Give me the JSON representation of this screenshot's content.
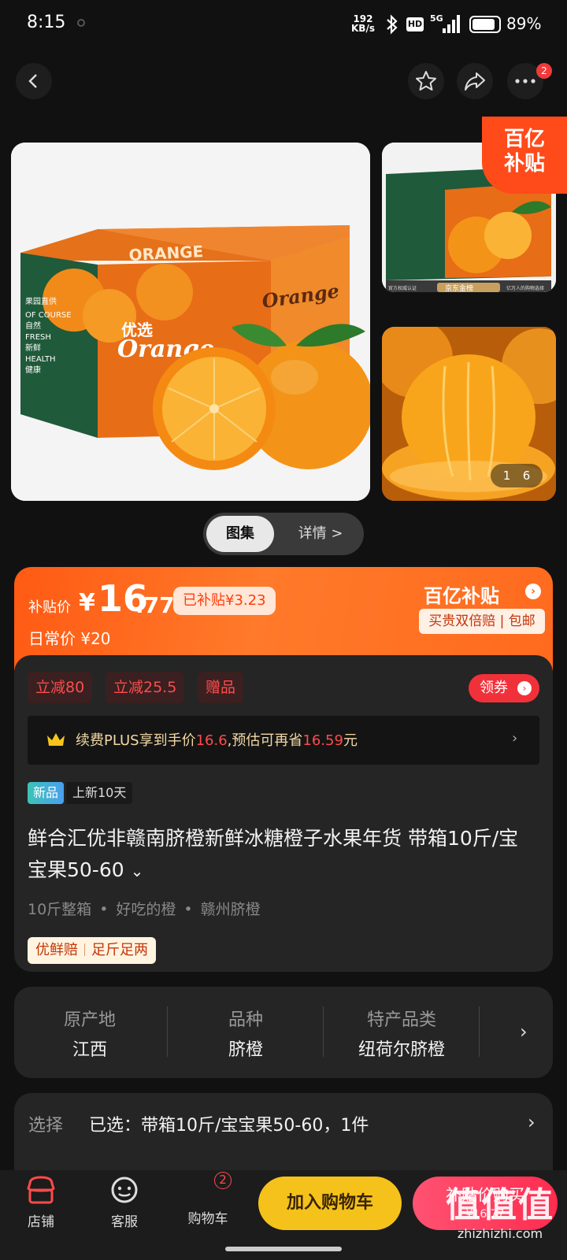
{
  "status_bar": {
    "time": "8:15",
    "net_speed_value": "192",
    "net_speed_unit": "KB/s",
    "hd": "HD",
    "network": "5G",
    "battery_pct": "89%",
    "battery_level": 0.89
  },
  "nav": {
    "more_badge": "2"
  },
  "gallery": {
    "corner_line1": "百亿",
    "corner_line2": "补贴",
    "page_current": "1",
    "page_total": "6",
    "main_box_text": "ORANGE",
    "main_box_side": [
      "果园直供",
      "OF COURSE",
      "自然",
      "FRESH",
      "新鲜",
      "HEALTH",
      "健康"
    ],
    "main_box_brand": "优选",
    "main_box_script": "Orange",
    "thumb1_banner": "京东金榜",
    "thumb1_left": "官方权威认证",
    "thumb1_right": "亿万人的购物选择"
  },
  "view_toggle": {
    "gallery_label": "图集",
    "details_label": "详情 >"
  },
  "price": {
    "label": "补贴价",
    "yen": "¥",
    "integer": "16",
    "decimal": ".77",
    "subsidized": "已补贴¥3.23",
    "daily": "日常价 ¥20",
    "brand": "百亿补贴",
    "brand_arrow": "›",
    "slogan": "买贵双倍赔 | 包邮"
  },
  "promos": {
    "tag1": "立减80",
    "tag2": "立减25.5",
    "tag3": "赠品",
    "coupon": "领券",
    "coupon_arrow": "›"
  },
  "plus": {
    "pre": "续费PLUS享到手价",
    "price": "16.6",
    "mid": ",预估可再省",
    "save": "16.59",
    "post": "元",
    "chevron": "›"
  },
  "new_badge": {
    "label": "新品",
    "date": "上新10天"
  },
  "product": {
    "title": "鲜合汇优非赣南脐橙新鲜冰糖橙子水果年货 带箱10斤/宝宝果50-60",
    "expand": "⌄",
    "spec1": "10斤整箱",
    "spec2": "好吃的橙",
    "spec3": "赣州脐橙",
    "dot": "•",
    "service1": "优鲜赔",
    "service2": "足斤足两"
  },
  "attributes": {
    "origin_key": "原产地",
    "origin_val": "江西",
    "variety_key": "品种",
    "variety_val": "脐橙",
    "category_key": "特产品类",
    "category_val": "纽荷尔脐橙",
    "chevron": "›"
  },
  "selection": {
    "label": "选择",
    "value": "已选：带箱10斤/宝宝果50-60，1件",
    "chevron": "›"
  },
  "bottom_bar": {
    "store": "店铺",
    "service": "客服",
    "cart": "购物车",
    "cart_count": "2",
    "add_cart": "加入购物车",
    "buy": "补贴价购买",
    "buy_price": "¥16.77"
  },
  "watermark": {
    "big": "值值值",
    "small": "zhizhizhi.com"
  },
  "colors": {
    "accent_orange": "#ff5a14",
    "buy_red": "#ff2c4f",
    "cart_yellow": "#f4c21b",
    "promo_red": "#ff4c4c"
  }
}
